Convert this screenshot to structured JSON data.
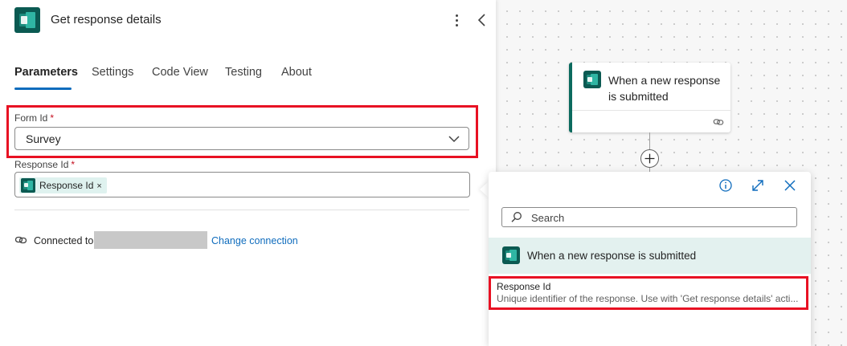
{
  "panel": {
    "title": "Get response details",
    "tabs": [
      {
        "label": "Parameters",
        "active": true
      },
      {
        "label": "Settings",
        "active": false
      },
      {
        "label": "Code View",
        "active": false
      },
      {
        "label": "Testing",
        "active": false
      },
      {
        "label": "About",
        "active": false
      }
    ],
    "form_id": {
      "label": "Form Id",
      "required_mark": "*",
      "value": "Survey"
    },
    "response_id": {
      "label": "Response Id",
      "required_mark": "*",
      "token_label": "Response Id",
      "token_remove": "×"
    },
    "connection": {
      "label": "Connected to",
      "change_label": "Change connection"
    }
  },
  "canvas": {
    "trigger_card": {
      "title": "When a new response is submitted"
    }
  },
  "flyout": {
    "search_placeholder": "Search",
    "group": {
      "label": "When a new response is submitted"
    },
    "item": {
      "name": "Response Id",
      "description": "Unique identifier of the response. Use with 'Get response details' acti..."
    }
  },
  "colors": {
    "accent": "#0f6cbd",
    "highlight": "#e81123",
    "forms_brand": "#0b5a52",
    "group_bg": "#e3f1ef",
    "token_bg": "#dff2ef"
  },
  "icons": [
    "forms-app-icon",
    "more-vertical-icon",
    "chevron-left-icon",
    "chevron-down-icon",
    "link-icon",
    "plus-icon",
    "info-icon",
    "expand-icon",
    "close-icon",
    "search-icon"
  ]
}
